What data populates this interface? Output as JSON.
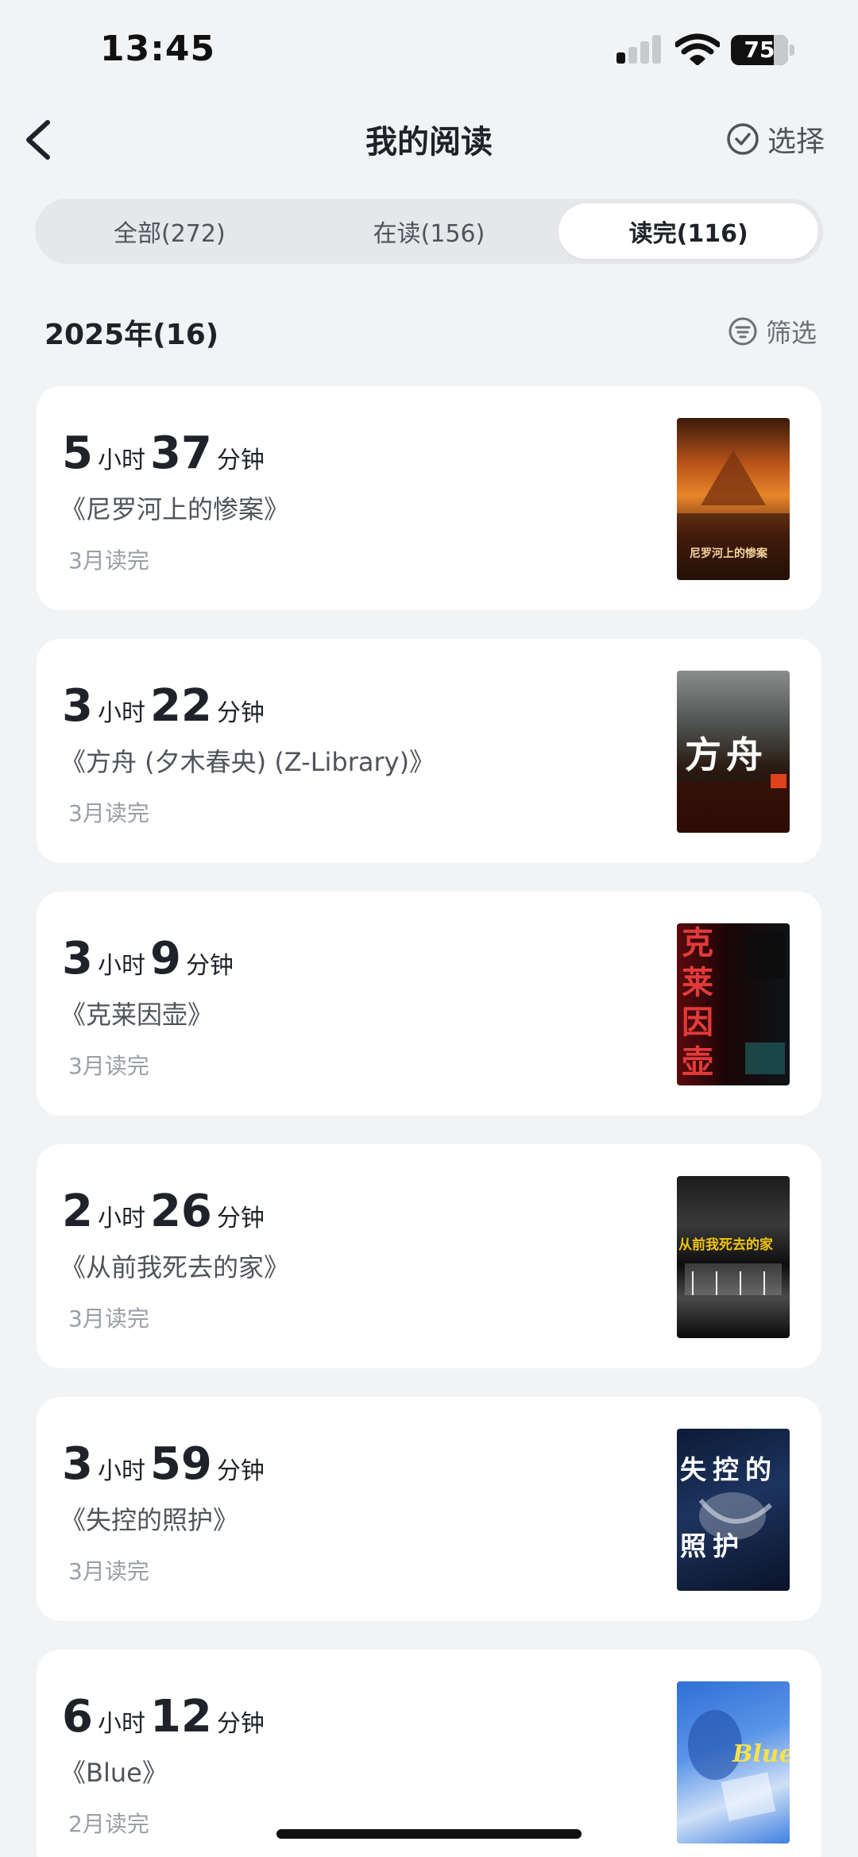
{
  "status_bar": {
    "time": "13:45",
    "battery": "75",
    "battery_level": 0.75
  },
  "header": {
    "title": "我的阅读",
    "select_label": "选择"
  },
  "tabs": [
    {
      "label": "全部(272)",
      "active": false
    },
    {
      "label": "在读(156)",
      "active": false
    },
    {
      "label": "读完(116)",
      "active": true
    }
  ],
  "section": {
    "title": "2025年(16)",
    "filter_label": "筛选"
  },
  "books": [
    {
      "hours": "5",
      "hour_unit": "小时",
      "minutes": "37",
      "minute_unit": "分钟",
      "title": "《尼罗河上的惨案》",
      "finished": "3月读完",
      "cover_text": "尼罗河上的惨案"
    },
    {
      "hours": "3",
      "hour_unit": "小时",
      "minutes": "22",
      "minute_unit": "分钟",
      "title": "《方舟 (夕木春央) (Z-Library)》",
      "finished": "3月读完",
      "cover_text": "方舟"
    },
    {
      "hours": "3",
      "hour_unit": "小时",
      "minutes": "9",
      "minute_unit": "分钟",
      "title": "《克莱因壶》",
      "finished": "3月读完",
      "cover_text": "克莱因壶"
    },
    {
      "hours": "2",
      "hour_unit": "小时",
      "minutes": "26",
      "minute_unit": "分钟",
      "title": "《从前我死去的家》",
      "finished": "3月读完",
      "cover_text": "从前我死去的家"
    },
    {
      "hours": "3",
      "hour_unit": "小时",
      "minutes": "59",
      "minute_unit": "分钟",
      "title": "《失控的照护》",
      "finished": "3月读完",
      "cover_text": "失控的照护"
    },
    {
      "hours": "6",
      "hour_unit": "小时",
      "minutes": "12",
      "minute_unit": "分钟",
      "title": "《Blue》",
      "finished": "2月读完",
      "cover_text": "Blue"
    }
  ],
  "colors": {
    "background": "#f2f3f5",
    "card": "#ffffff",
    "text_primary": "#1f2329",
    "text_muted": "#9a9ea6"
  }
}
